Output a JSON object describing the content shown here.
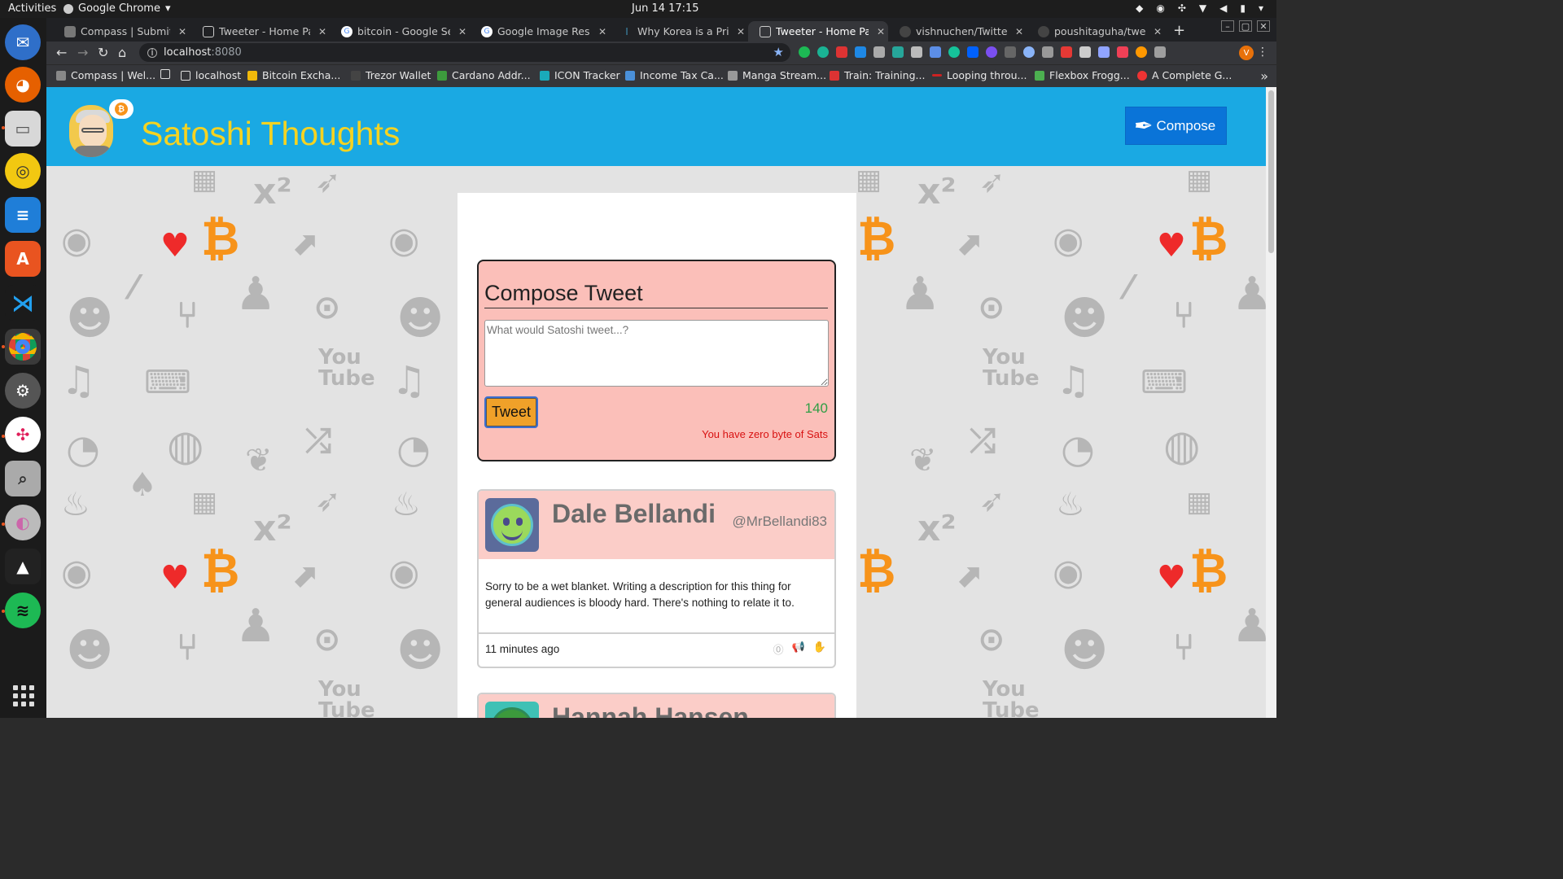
{
  "system": {
    "activities": "Activities",
    "app_name": "Google Chrome",
    "clock": "Jun 14  17:15"
  },
  "browser": {
    "tabs": [
      {
        "title": "Compass | Submit Pr",
        "icon": "compass-icon",
        "active": false
      },
      {
        "title": "Tweeter - Home Page",
        "icon": "page-icon",
        "active": false
      },
      {
        "title": "bitcoin - Google Searc",
        "icon": "google-icon",
        "active": false
      },
      {
        "title": "Google Image Result",
        "icon": "google-icon",
        "active": false
      },
      {
        "title": "Why Korea is a Prime",
        "icon": "blog-icon",
        "active": false
      },
      {
        "title": "Tweeter - Home Page",
        "icon": "page-icon",
        "active": true
      },
      {
        "title": "vishnuchen/Twitter-",
        "icon": "github-icon",
        "active": false
      },
      {
        "title": "poushitaguha/tweet",
        "icon": "github-icon",
        "active": false
      }
    ],
    "url_host": "localhost",
    "url_port": ":8080",
    "profile_initial": "V",
    "bookmarks": [
      {
        "label": "Compass | Wel...",
        "color": "#888"
      },
      {
        "label": "",
        "color": "#ddd"
      },
      {
        "label": "localhost",
        "color": "#ddd"
      },
      {
        "label": "Bitcoin Excha...",
        "color": "#f0b90b"
      },
      {
        "label": "Trezor Wallet",
        "color": "#444"
      },
      {
        "label": "Cardano Addr...",
        "color": "#3d9b3d"
      },
      {
        "label": "ICON Tracker",
        "color": "#1aaaba"
      },
      {
        "label": "Income Tax Ca...",
        "color": "#4a90d9"
      },
      {
        "label": "Manga Stream...",
        "color": "#999"
      },
      {
        "label": "Train: Training...",
        "color": "#d33"
      },
      {
        "label": "Looping throu...",
        "color": "#c22"
      },
      {
        "label": "Flexbox Frogg...",
        "color": "#4caf50"
      },
      {
        "label": "A Complete G...",
        "color": "#e33"
      }
    ]
  },
  "header": {
    "title": "Satoshi Thoughts",
    "compose_label": "Compose"
  },
  "compose": {
    "heading": "Compose Tweet",
    "placeholder": "What would Satoshi tweet...?",
    "button_label": "Tweet",
    "counter": "140",
    "warning": "You have zero byte of Sats"
  },
  "tweets": [
    {
      "name": "Dale Bellandi",
      "handle": "@MrBellandi83",
      "text": "Sorry to be a wet blanket. Writing a description for this thing for general audiences is bloody hard. There's nothing to relate it to.",
      "time": "11 minutes ago"
    },
    {
      "name": "Hannah Hansen",
      "handle": "",
      "text": "",
      "time": ""
    }
  ],
  "colors": {
    "header_bg": "#1aa9e3",
    "title": "#f5d321",
    "compose_btn": "#0a74d8",
    "card_bg": "#fbbfb9",
    "counter": "#2f9e44",
    "warning": "#d81212"
  }
}
